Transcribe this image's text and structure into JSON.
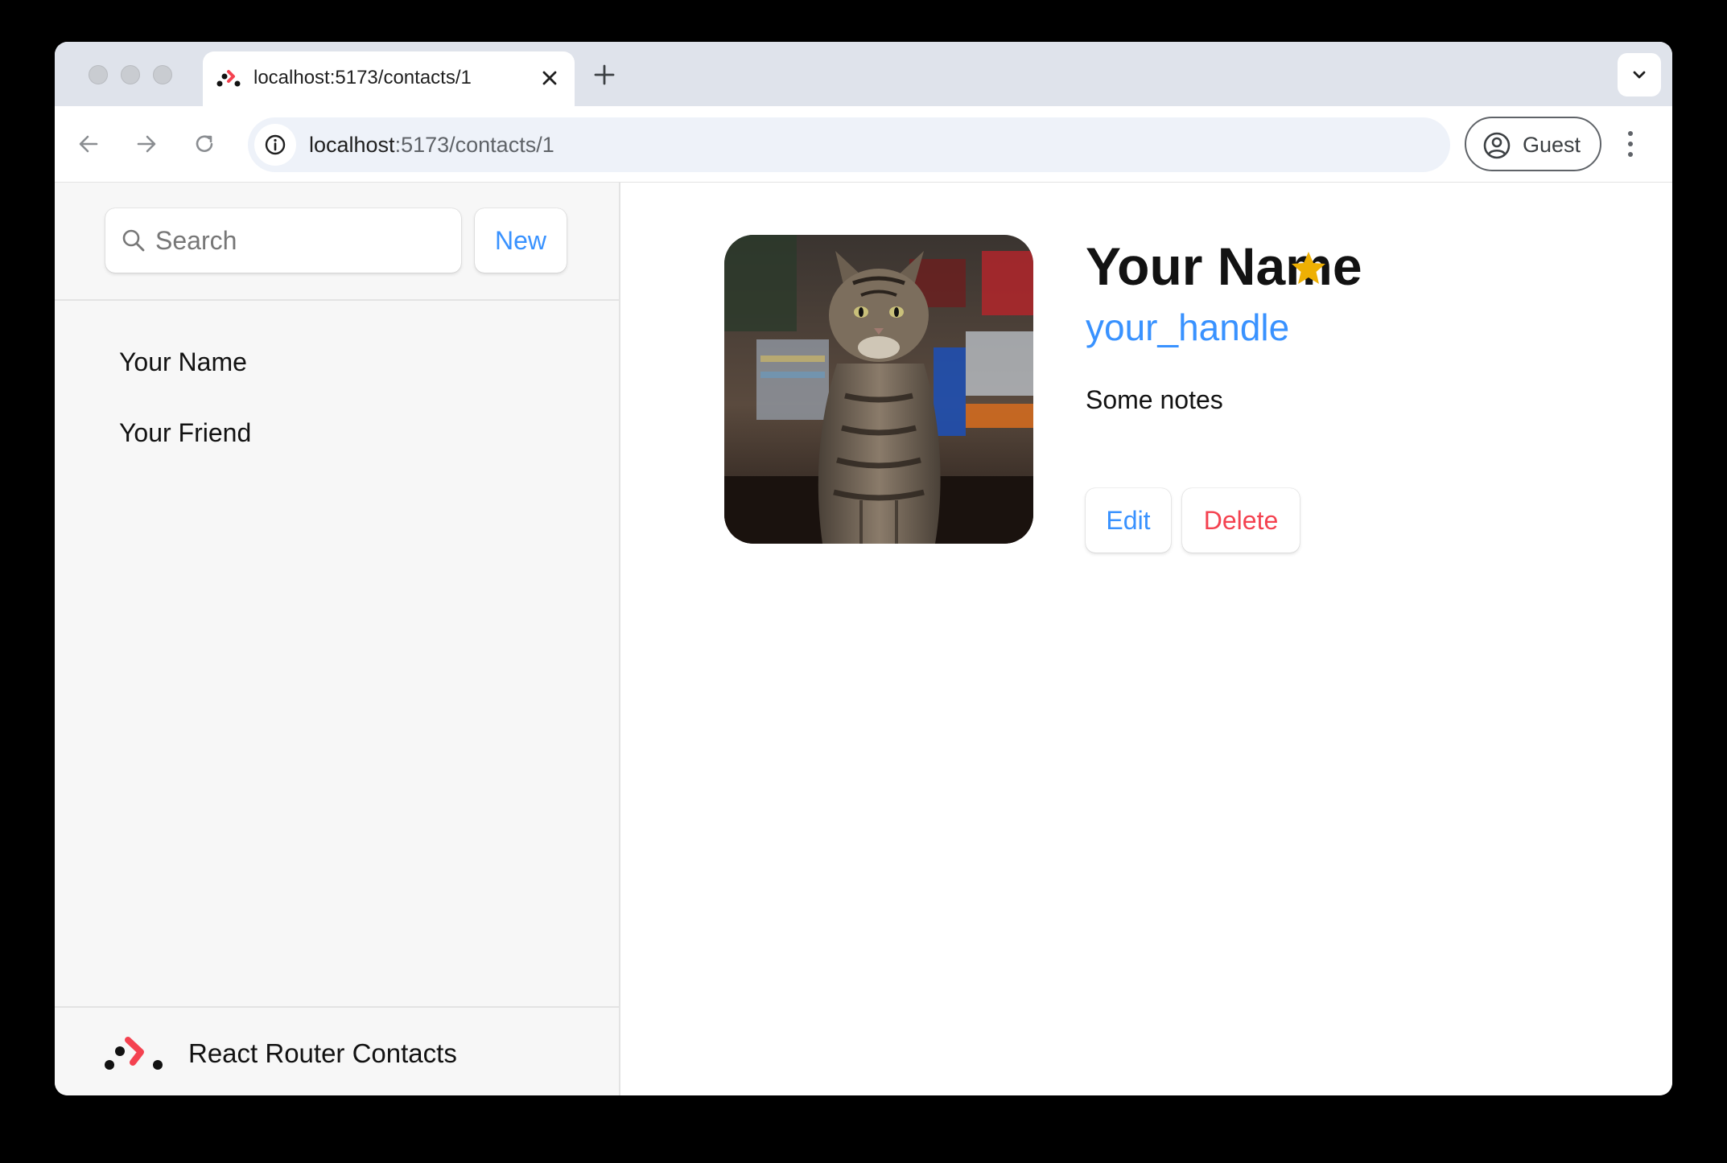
{
  "browser": {
    "tab": {
      "title": "localhost:5173/contacts/1"
    },
    "url": {
      "host": "localhost",
      "rest": ":5173/contacts/1"
    },
    "profile": {
      "label": "Guest"
    }
  },
  "sidebar": {
    "search": {
      "placeholder": "Search",
      "value": ""
    },
    "new_label": "New",
    "contacts": [
      "Your Name",
      "Your Friend"
    ],
    "footer_title": "React Router Contacts"
  },
  "contact": {
    "name": "Your Name",
    "favorite": true,
    "handle": "your_handle",
    "notes": "Some notes",
    "edit_label": "Edit",
    "delete_label": "Delete",
    "avatar_alt": "cat photo"
  },
  "colors": {
    "accent": "#3992ff",
    "danger": "#f44250",
    "star": "#eeb004",
    "logo_red": "#f44250"
  }
}
